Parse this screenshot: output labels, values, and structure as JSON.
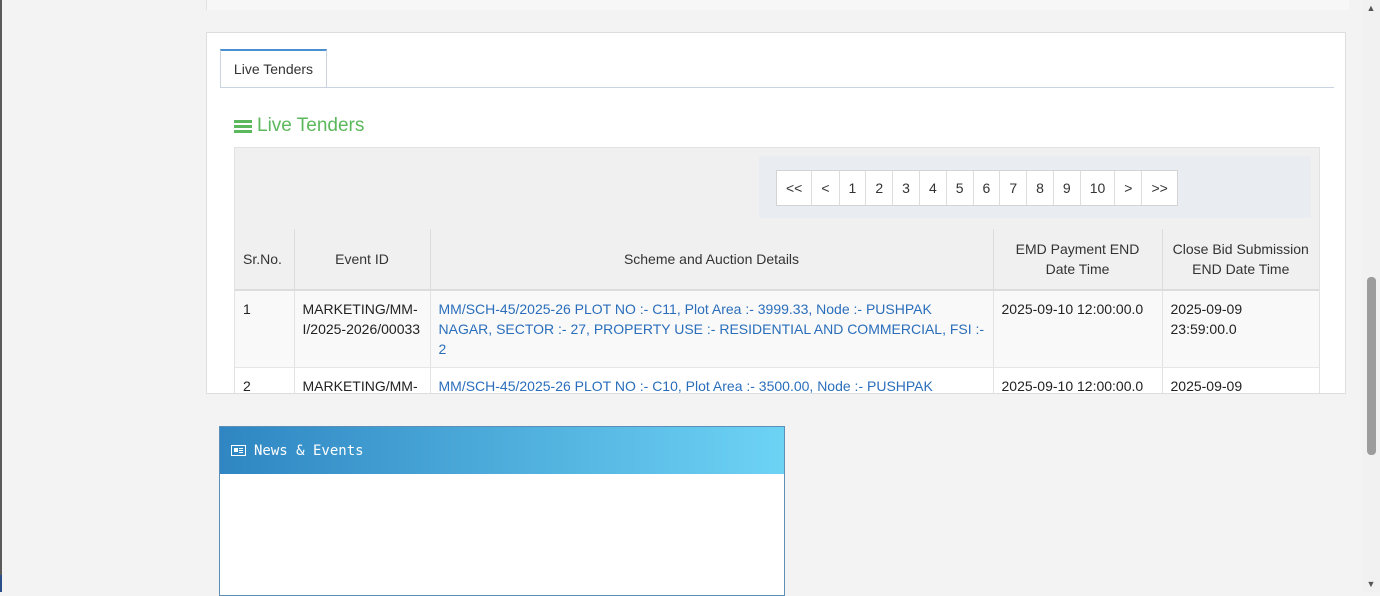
{
  "tab": {
    "label": "Live Tenders"
  },
  "section": {
    "title": "Live Tenders",
    "icon": "list-icon"
  },
  "pagination": [
    "<<",
    "<",
    "1",
    "2",
    "3",
    "4",
    "5",
    "6",
    "7",
    "8",
    "9",
    "10",
    ">",
    ">>"
  ],
  "table": {
    "headers": [
      "Sr.No.",
      "Event ID",
      "Scheme and Auction Details",
      "EMD Payment END Date Time",
      "Close Bid Submission END Date Time"
    ],
    "rows": [
      {
        "sr": "1",
        "event_id": "MARKETING/MM-I/2025-2026/00033",
        "details": "MM/SCH-45/2025-26 PLOT NO :- C11, Plot Area :- 3999.33, Node :- PUSHPAK NAGAR, SECTOR :- 27, PROPERTY USE :- RESIDENTIAL AND COMMERCIAL, FSI :- 2",
        "emd_end": "2025-09-10 12:00:00.0",
        "close_bid_end": "2025-09-09 23:59:00.0"
      },
      {
        "sr": "2",
        "event_id": "MARKETING/MM-",
        "details": "MM/SCH-45/2025-26 PLOT NO :- C10, Plot Area :- 3500.00, Node :- PUSHPAK",
        "emd_end": "2025-09-10 12:00:00.0",
        "close_bid_end": "2025-09-09"
      }
    ]
  },
  "news": {
    "title": "News & Events",
    "icon": "newspaper-icon"
  },
  "colors": {
    "accent_green": "#5cb85c",
    "link_blue": "#2a6ebb",
    "news_gradient_start": "#2f86c2",
    "news_gradient_end": "#6dd3f5"
  }
}
